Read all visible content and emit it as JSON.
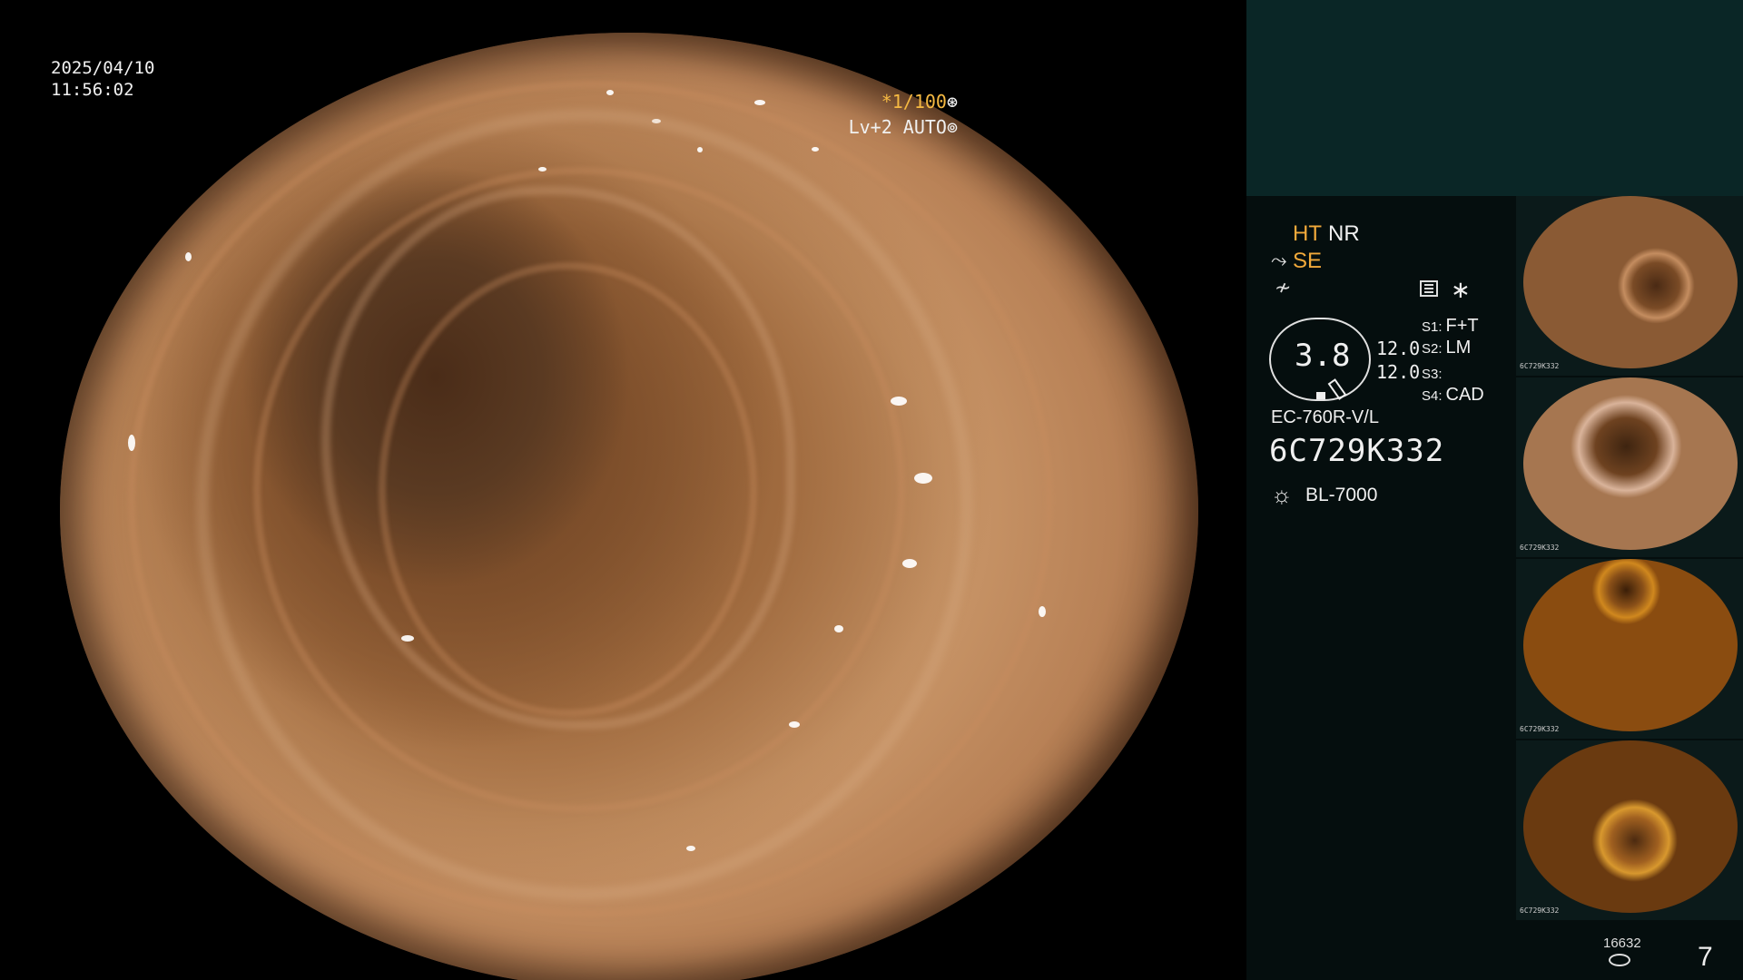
{
  "overlay": {
    "date": "2025/04/10",
    "time": "11:56:02",
    "shutter": "*1/100",
    "shutter_icon": "aperture-icon",
    "level": "Lv+2 AUTO",
    "level_icon": "iris-icon"
  },
  "panel": {
    "ht": "HT",
    "nr": "NR",
    "se": "SE",
    "se_icon": "structure-enhance-icon",
    "fx_icon": "color-mode-icon",
    "filter_icon": "filter-settings-icon",
    "star": "∗",
    "gauge_value": "3.8",
    "value1": "12.0",
    "value2": "12.0",
    "slots": [
      {
        "key": "S1:",
        "val": "F+T"
      },
      {
        "key": "S2:",
        "val": "LM"
      },
      {
        "key": "S3:",
        "val": ""
      },
      {
        "key": "S4:",
        "val": "CAD"
      }
    ],
    "model": "EC-760R-V/L",
    "serial": "6C729K332",
    "light_icon": "light-source-icon",
    "light": "BL-7000"
  },
  "thumbnails": [
    {
      "caption": "6C729K332"
    },
    {
      "caption": "6C729K332"
    },
    {
      "caption": "6C729K332"
    },
    {
      "caption": "6C729K332"
    }
  ],
  "footer": {
    "counter": "16632",
    "page": "7"
  },
  "colors": {
    "accent": "#f2a93b",
    "panel_top": "#0a2626",
    "panel_bg": "#050e0e"
  }
}
